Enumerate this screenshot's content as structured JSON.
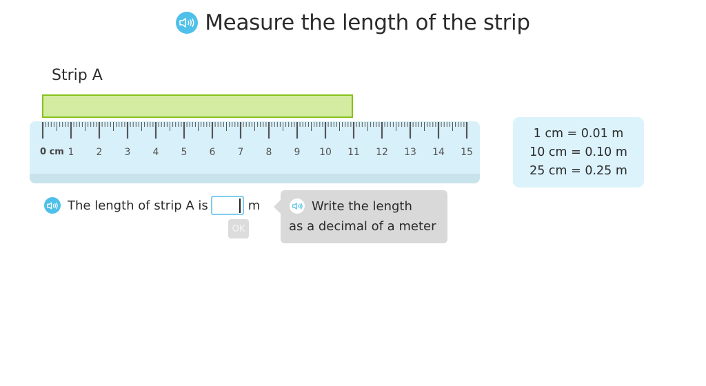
{
  "header": {
    "title": "Measure the length of the strip",
    "audio_icon": "speaker-icon"
  },
  "strip": {
    "label": "Strip A",
    "length_cm": 11,
    "fill_color": "#d4eba2",
    "border_color": "#86c21d"
  },
  "ruler": {
    "unit_label": "0 cm",
    "min": 0,
    "max": 15,
    "subdivisions_per_unit": 10,
    "labels": [
      "1",
      "2",
      "3",
      "4",
      "5",
      "6",
      "7",
      "8",
      "9",
      "10",
      "11",
      "12",
      "13",
      "14",
      "15"
    ],
    "color": "#d8f0f9"
  },
  "conversions": {
    "lines": [
      "1 cm = 0.01 m",
      "10 cm = 0.10 m",
      "25 cm = 0.25 m"
    ]
  },
  "question": {
    "prefix": "The length of strip A is",
    "input_value": "",
    "input_placeholder": "",
    "unit": "m",
    "ok_label": "OK"
  },
  "hint": {
    "line1": "Write the length",
    "line2": "as a decimal of a meter"
  },
  "colors": {
    "accent": "#4fc0ea",
    "input_border": "#7fcdee",
    "hint_bg": "#d9d9d9"
  }
}
